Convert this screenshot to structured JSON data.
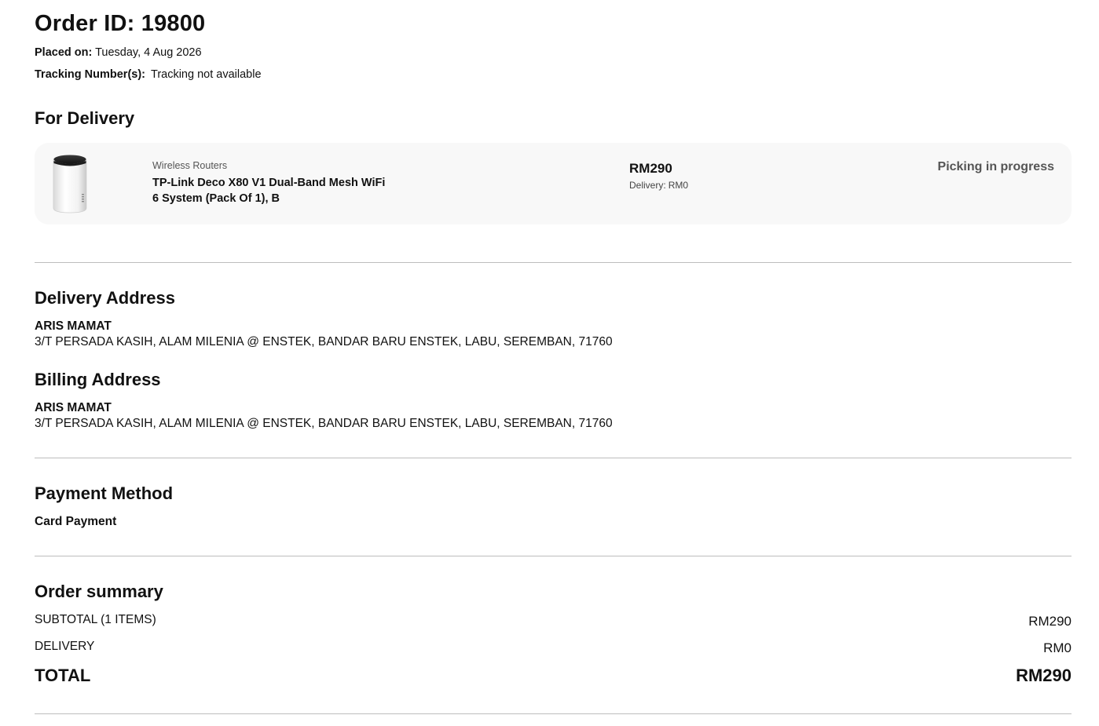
{
  "order": {
    "title": "Order ID: 19800",
    "placed_label": "Placed on:",
    "placed_value": "Tuesday, 4 Aug 2026",
    "tracking_label": "Tracking Number(s):",
    "tracking_value": "Tracking not available"
  },
  "delivery_section": {
    "heading": "For Delivery",
    "item": {
      "image_icon": "router-product-image",
      "category": "Wireless Routers",
      "name": "TP-Link Deco X80 V1 Dual-Band Mesh WiFi 6 System (Pack Of 1), B",
      "price": "RM290",
      "delivery_label": "Delivery:",
      "delivery_value": "RM0",
      "status": "Picking in progress"
    }
  },
  "delivery_address": {
    "heading": "Delivery Address",
    "name": "ARIS MAMAT",
    "line": "3/T PERSADA KASIH, ALAM MILENIA @ ENSTEK, BANDAR BARU ENSTEK, LABU, SEREMBAN, 71760"
  },
  "billing_address": {
    "heading": "Billing Address",
    "name": "ARIS MAMAT",
    "line": "3/T PERSADA KASIH, ALAM MILENIA @ ENSTEK, BANDAR BARU ENSTEK, LABU, SEREMBAN, 71760"
  },
  "payment": {
    "heading": "Payment Method",
    "method": "Card Payment"
  },
  "summary": {
    "heading": "Order summary",
    "subtotal_label": "SUBTOTAL (1 ITEMS)",
    "subtotal_value": "RM290",
    "delivery_label": "DELIVERY",
    "delivery_value": "RM0",
    "total_label": "TOTAL",
    "total_value": "RM290"
  },
  "colors": {
    "card_background": "#f8f8f8",
    "divider": "#bdbdbd",
    "status_text": "#555555"
  }
}
